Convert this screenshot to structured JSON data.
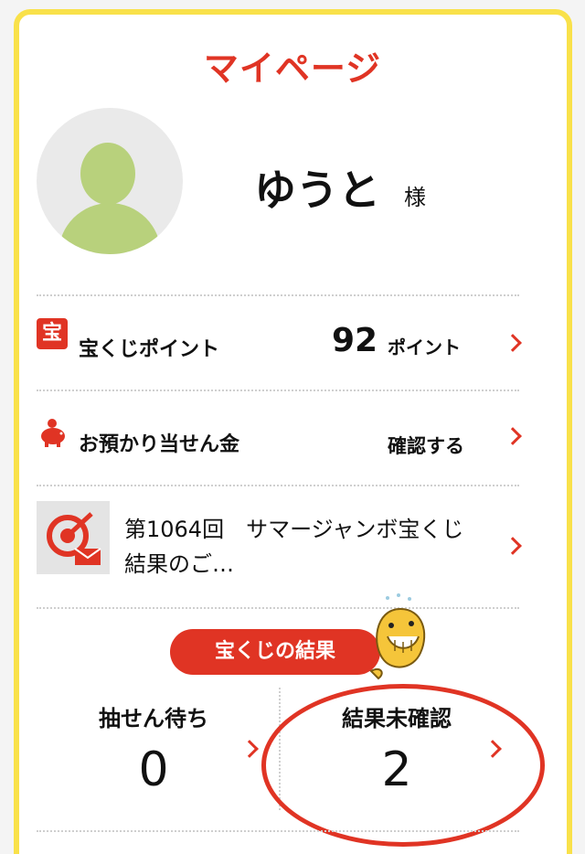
{
  "header": {
    "title": "マイページ"
  },
  "user": {
    "name": "ゆうと",
    "suffix": "様"
  },
  "points": {
    "icon_text": "宝",
    "label": "宝くじポイント",
    "value": "92",
    "unit": "ポイント"
  },
  "deposit": {
    "label": "お預かり当せん金",
    "action": "確認する"
  },
  "news": {
    "text": "第1064回　サマージャンボ宝くじ結果のご…"
  },
  "results": {
    "tag": "宝くじの結果",
    "pending": {
      "label": "抽せん待ち",
      "value": "0"
    },
    "unchecked": {
      "label": "結果未確認",
      "value": "2"
    }
  },
  "colors": {
    "accent": "#e03424",
    "frame": "#f9e14a",
    "avatar": "#b8d17c",
    "mascot": "#f5c53a"
  },
  "icons": [
    "avatar-icon",
    "takarakuji-icon",
    "piggy-bank-icon",
    "target-mail-icon",
    "chevron-right-icon",
    "whale-mascot"
  ]
}
